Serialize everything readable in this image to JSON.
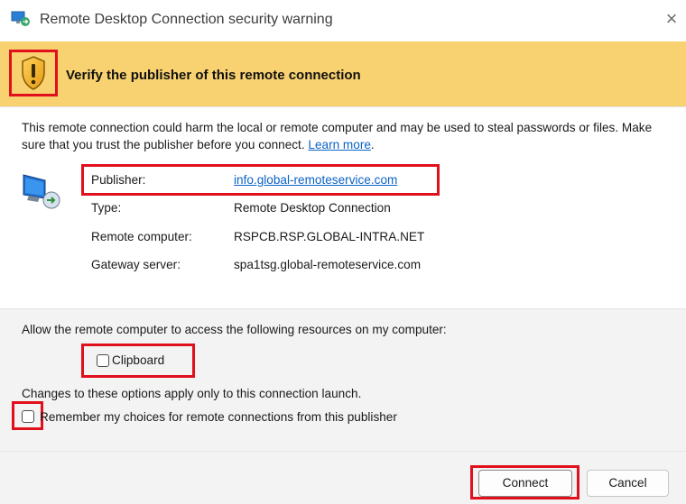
{
  "window": {
    "title": "Remote Desktop Connection security warning",
    "close_glyph": "×"
  },
  "banner": {
    "heading": "Verify the publisher of this remote connection",
    "icon": "shield-warning-icon"
  },
  "description": {
    "text": "This remote connection could harm the local or remote computer and may be used to steal passwords or files. Make sure that you trust the publisher before you connect. ",
    "link": "Learn more",
    "suffix": "."
  },
  "details": {
    "publisher_label": "Publisher:",
    "publisher_value": "info.global-remoteservice.com",
    "type_label": "Type:",
    "type_value": "Remote Desktop Connection",
    "remote_label": "Remote computer:",
    "remote_value": "RSPCB.RSP.GLOBAL-INTRA.NET",
    "gateway_label": "Gateway server:",
    "gateway_value": "spa1tsg.global-remoteservice.com"
  },
  "resources": {
    "allow_text": "Allow the remote computer to access the following resources on my computer:",
    "clipboard_label": "Clipboard",
    "clipboard_checked": false,
    "changes_text": "Changes to these options apply only to this connection launch.",
    "remember_label": "Remember my choices for remote connections from this publisher",
    "remember_checked": false
  },
  "buttons": {
    "connect": "Connect",
    "cancel": "Cancel"
  },
  "colors": {
    "banner": "#f8d170",
    "highlight": "#e0101c",
    "link": "#0b63c6"
  }
}
